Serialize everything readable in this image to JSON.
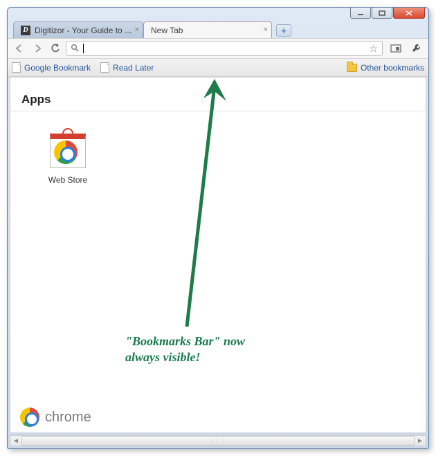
{
  "window_buttons": {
    "minimize": "–",
    "maximize": "▢",
    "close": "✕"
  },
  "tabs": [
    {
      "label": "Digitizor - Your Guide to ...",
      "active": false
    },
    {
      "label": "New Tab",
      "active": true
    }
  ],
  "newtab_plus": "+",
  "omnibox": {
    "value": ""
  },
  "bookmarks": {
    "items": [
      {
        "label": "Google Bookmark"
      },
      {
        "label": "Read Later"
      }
    ],
    "other": "Other bookmarks"
  },
  "content": {
    "apps_heading": "Apps",
    "webstore_label": "Web Store",
    "brand": "chrome"
  },
  "annotation": {
    "line1": "\"Bookmarks Bar\" now",
    "line2": "always visible!"
  }
}
